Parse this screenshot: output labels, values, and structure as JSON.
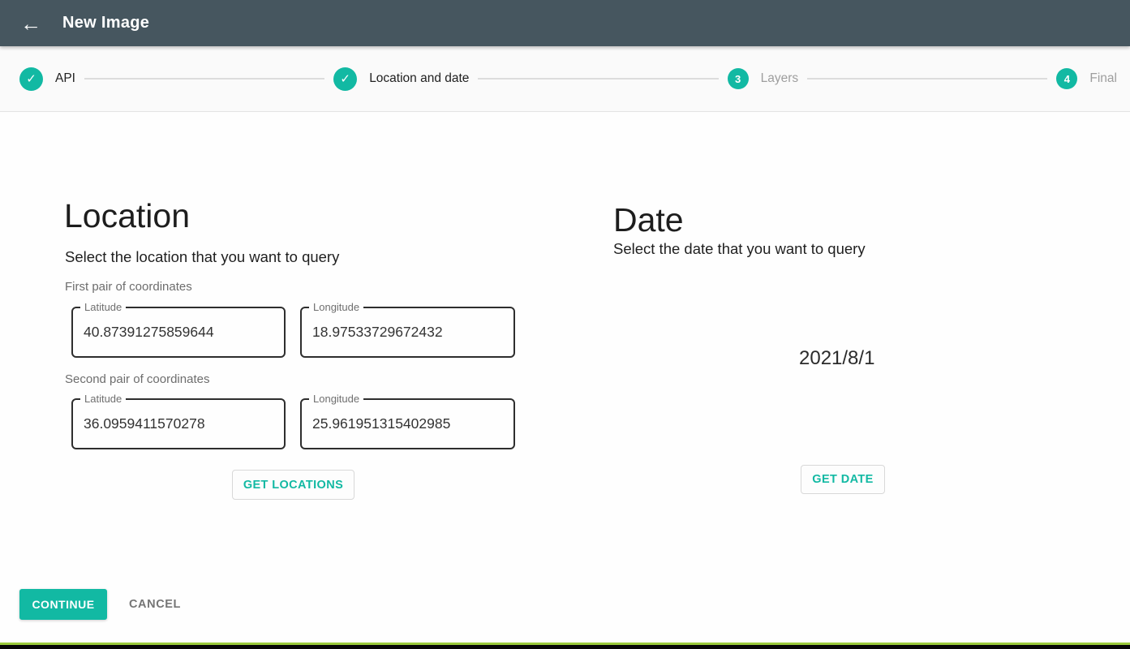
{
  "appbar": {
    "title": "New Image",
    "back_icon_glyph": "←",
    "background_color": "#46565f"
  },
  "stepper": {
    "accent_color": "#12b9a3",
    "completed_icon_glyph": "✓",
    "steps": [
      {
        "label": "API",
        "state": "completed"
      },
      {
        "label": "Location and date",
        "state": "completed"
      },
      {
        "label": "Layers",
        "state": "upcoming",
        "number": "3"
      },
      {
        "label": "Final",
        "state": "upcoming",
        "number": "4"
      }
    ]
  },
  "location": {
    "title": "Location",
    "subtitle": "Select the location that you want to query",
    "first_pair_label": "First pair of coordinates",
    "second_pair_label": "Second pair of coordinates",
    "fields": {
      "first_latitude": {
        "label": "Latitude",
        "value": "40.87391275859644"
      },
      "first_longitude": {
        "label": "Longitude",
        "value": "18.97533729672432"
      },
      "second_latitude": {
        "label": "Latitude",
        "value": "36.0959411570278"
      },
      "second_longitude": {
        "label": "Longitude",
        "value": "25.961951315402985"
      }
    },
    "get_locations_label": "GET LOCATIONS"
  },
  "date": {
    "title": "Date",
    "subtitle": "Select the date that you want to query",
    "value": "2021/8/1",
    "get_date_label": "GET DATE"
  },
  "actions": {
    "continue_label": "CONTINUE",
    "cancel_label": "CANCEL"
  }
}
